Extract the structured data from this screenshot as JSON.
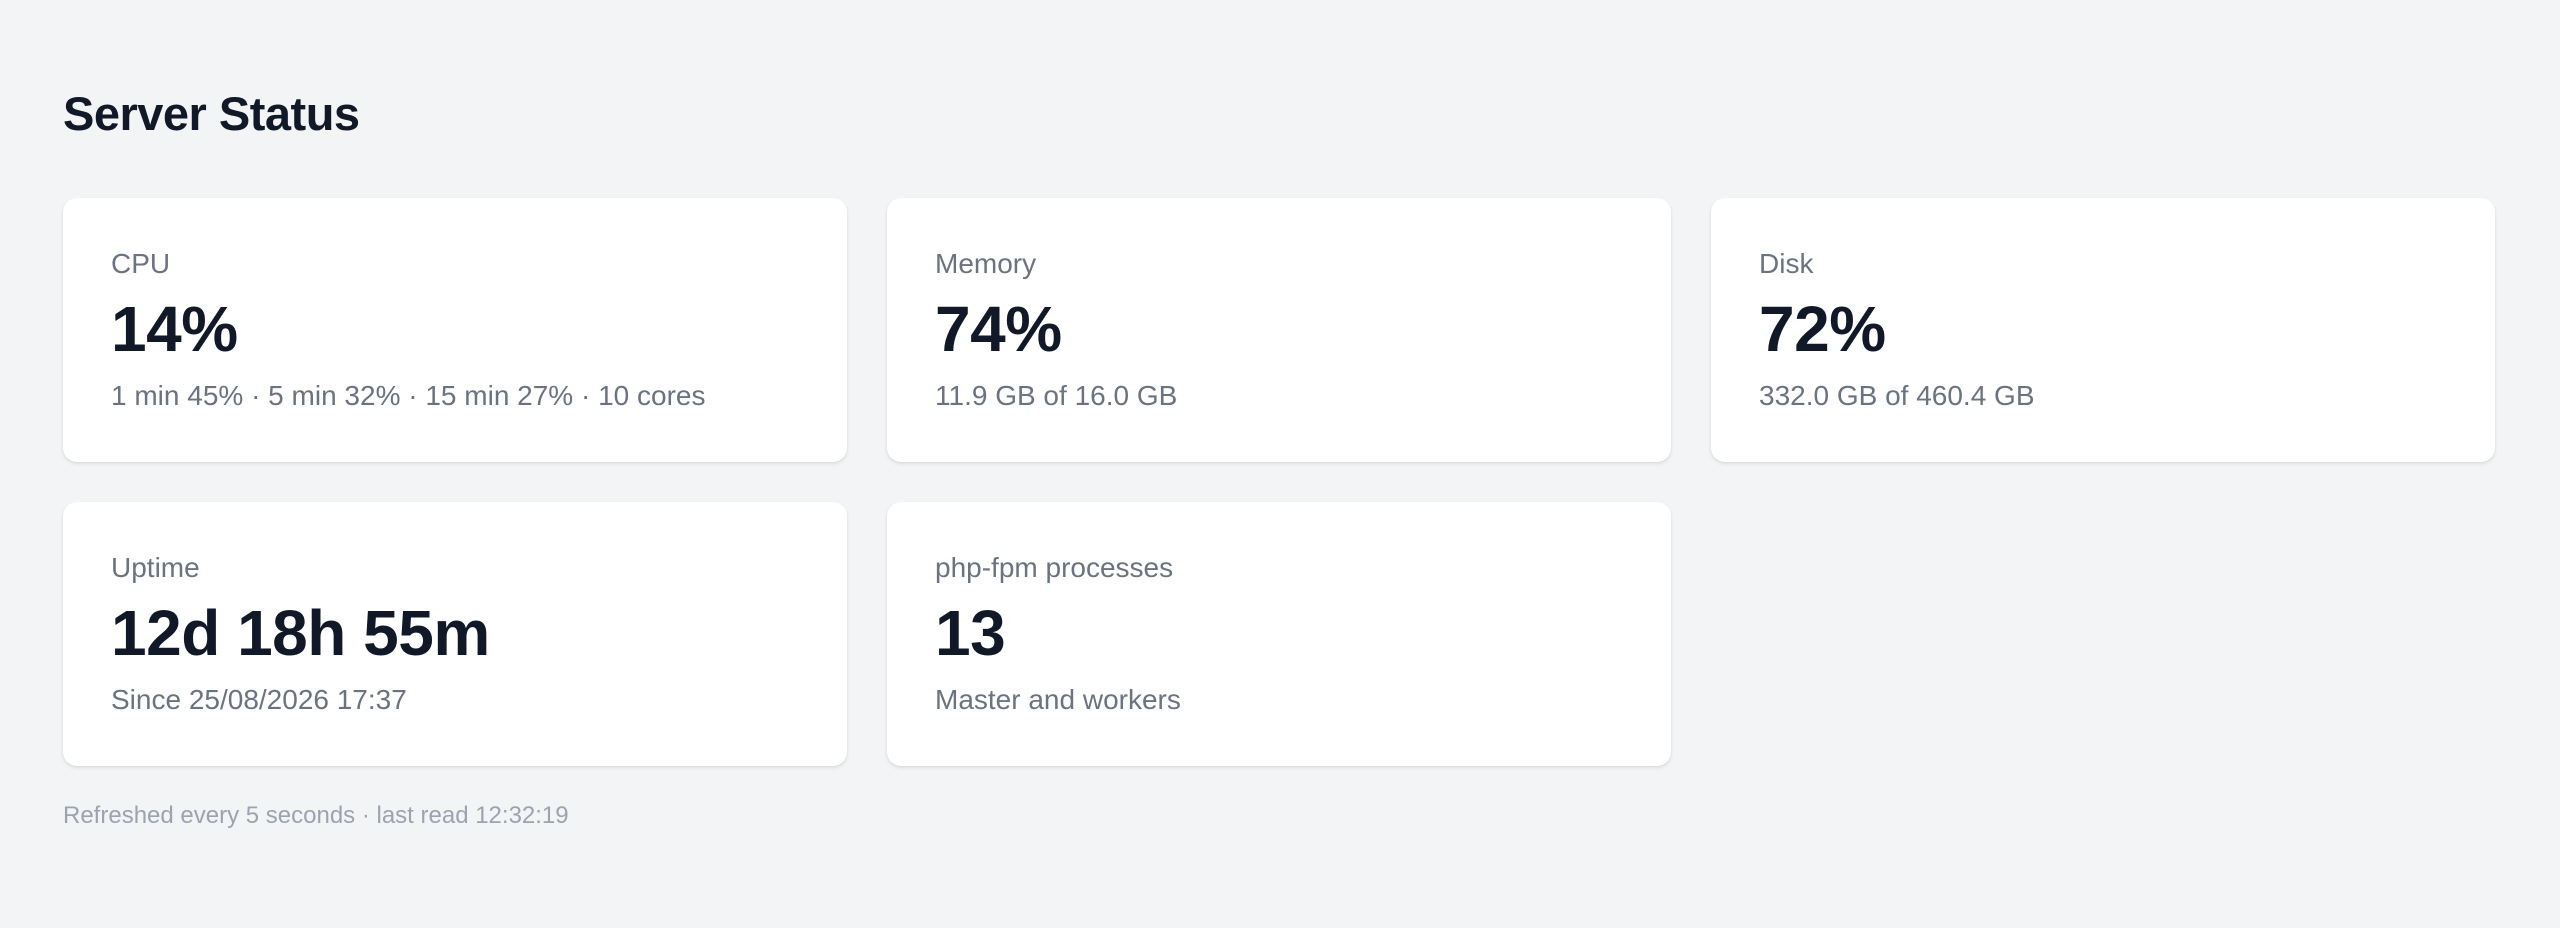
{
  "page": {
    "title": "Server Status"
  },
  "cards": [
    {
      "label": "CPU",
      "value": "14%",
      "sub": "1 min 45% · 5 min 32% · 15 min 27% · 10 cores"
    },
    {
      "label": "Memory",
      "value": "74%",
      "sub": "11.9 GB of 16.0 GB"
    },
    {
      "label": "Disk",
      "value": "72%",
      "sub": "332.0 GB of 460.4 GB"
    },
    {
      "label": "Uptime",
      "value": "12d 18h 55m",
      "sub": "Since 25/08/2026 17:37"
    },
    {
      "label": "php-fpm processes",
      "value": "13",
      "sub": "Master and workers"
    }
  ],
  "footer": {
    "note": "Refreshed every 5 seconds · last read 12:32:19"
  },
  "colors": {
    "background": "#f3f4f6",
    "card": "#ffffff",
    "text_primary": "#111827",
    "text_secondary": "#6b7280",
    "text_muted": "#9ca3af"
  }
}
